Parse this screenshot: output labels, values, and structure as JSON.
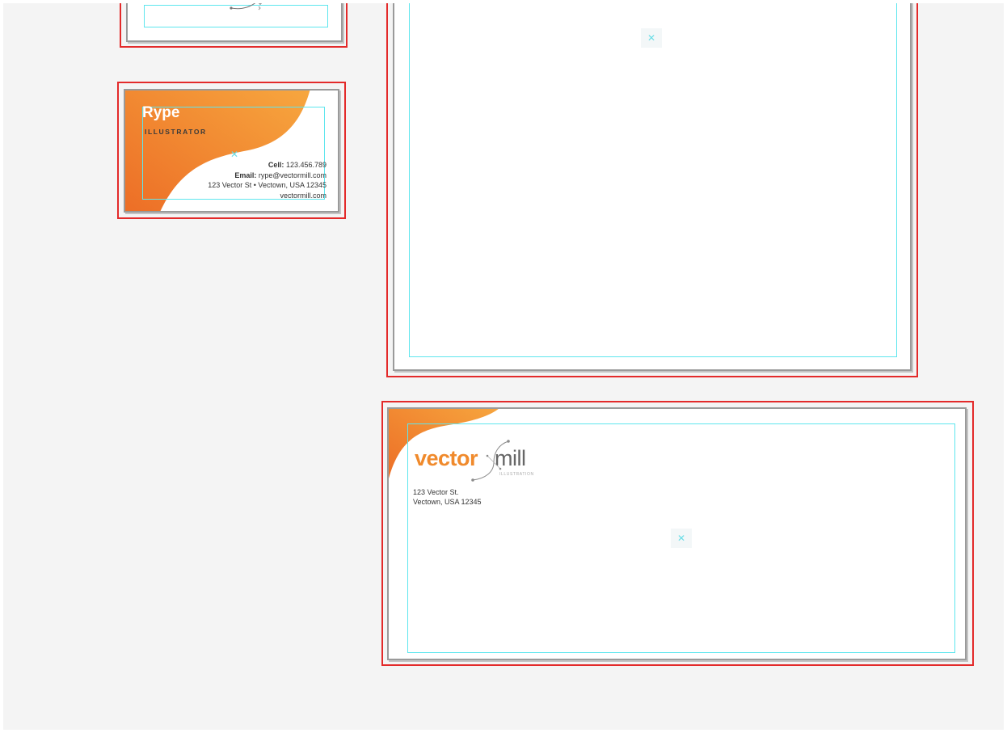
{
  "colors": {
    "bleed": "#e32a2a",
    "margin_guide": "#5ee6ee",
    "orange_light": "#f7a13a",
    "orange_dark": "#ec6b25",
    "pasteboard": "#f4f4f4"
  },
  "business_card": {
    "name": "Rype",
    "title": "ILLUSTRATOR",
    "cell_label": "Cell:",
    "cell_value": "123.456.789",
    "email_label": "Email:",
    "email_value": "rype@vectormill.com",
    "address": "123 Vector St • Vectown, USA 12345",
    "website": "vectormill.com"
  },
  "envelope": {
    "logo_left": "vector",
    "logo_right": "mill",
    "logo_tagline": "ILLUSTRATION",
    "address_line1": "123 Vector St.",
    "address_line2": "Vectown, USA 12345"
  },
  "icons": {
    "center_marker": "center-marker-icon",
    "logo_glyph": "pen-tool-curve-icon"
  },
  "glyphs": {
    "center_marker": "✕"
  }
}
